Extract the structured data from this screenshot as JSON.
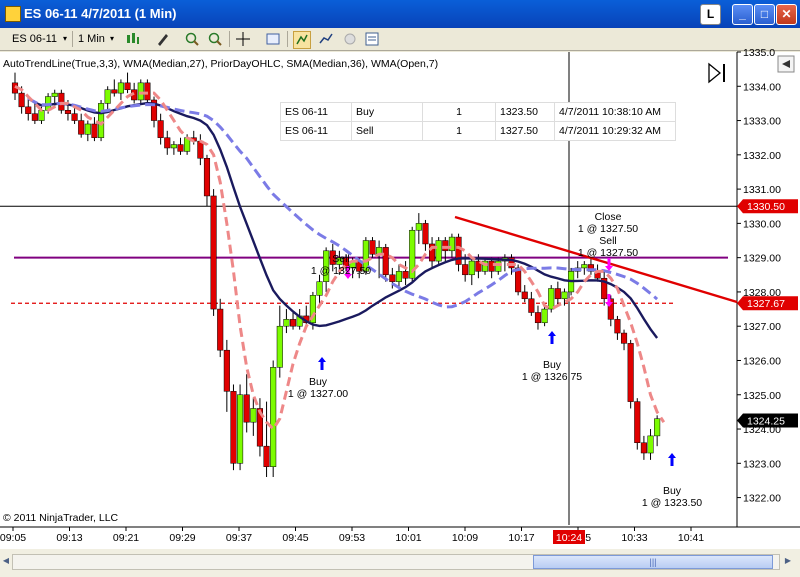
{
  "window": {
    "title": "ES 06-11  4/7/2011 (1 Min)",
    "link_label": "L",
    "minimize_label": "_",
    "maximize_label": "□",
    "close_label": "✕"
  },
  "toolbar": {
    "instrument": "ES 06-11",
    "interval": "1 Min",
    "dropdown_glyph": "▾",
    "icons": [
      "bar-style-icon",
      "drawing-tool-icon",
      "zoom-in-icon",
      "zoom-out-icon",
      "crosshair-icon",
      "properties-icon",
      "strategy-icon",
      "indicators-icon",
      "disabled-icon",
      "data-box-icon"
    ]
  },
  "indicators_label": "AutoTrendLine(True,3,3), WMA(Median,27), PriorDayOHLC, SMA(Median,36), WMA(Open,7)",
  "copyright": "© 2011 NinjaTrader, LLC",
  "executions": [
    {
      "instrument": "ES 06-11",
      "action": "Buy",
      "qty": "1",
      "price": "1323.50",
      "time": "4/7/2011 10:38:10 AM"
    },
    {
      "instrument": "ES 06-11",
      "action": "Sell",
      "qty": "1",
      "price": "1327.50",
      "time": "4/7/2011 10:29:32 AM"
    }
  ],
  "colors": {
    "up_bar": "#7cfc00",
    "down_bar": "#e00000",
    "wma27": "#1a1a5e",
    "sma36": "#7b7be6",
    "wma7": "#ee8888",
    "prior_close": "#800080",
    "prior_low": "#e00000",
    "trendline": "#e00000",
    "buy_arrow": "#0000ff",
    "sell_arrow": "#ff00ff"
  },
  "price_labels": {
    "last": "1324.25",
    "prior_close": "1330.50",
    "prior_low": "1327.67"
  },
  "time_badge": "10:24",
  "chart_data": {
    "type": "candlestick",
    "y_axis_ticks": [
      "1335.0",
      "1334.00",
      "1333.00",
      "1332.00",
      "1331.00",
      "1330.00",
      "1329.00",
      "1328.00",
      "1327.00",
      "1326.00",
      "1325.00",
      "1324.00",
      "1323.00",
      "1322.00"
    ],
    "ylim": [
      1321.2,
      1335.0
    ],
    "x_axis_ticks": [
      "09:05",
      "09:13",
      "09:21",
      "09:29",
      "09:37",
      "09:45",
      "09:53",
      "10:01",
      "10:09",
      "10:17",
      "10:25",
      "10:33",
      "10:41"
    ],
    "candles": [
      [
        1334.1,
        1334.4,
        1333.6,
        1333.8
      ],
      [
        1333.8,
        1334.0,
        1333.2,
        1333.4
      ],
      [
        1333.4,
        1333.7,
        1333.0,
        1333.2
      ],
      [
        1333.2,
        1333.5,
        1332.9,
        1333.0
      ],
      [
        1333.0,
        1333.4,
        1332.9,
        1333.3
      ],
      [
        1333.3,
        1333.8,
        1333.2,
        1333.7
      ],
      [
        1333.7,
        1333.9,
        1333.4,
        1333.8
      ],
      [
        1333.8,
        1333.9,
        1333.2,
        1333.3
      ],
      [
        1333.3,
        1333.6,
        1333.0,
        1333.2
      ],
      [
        1333.2,
        1333.4,
        1332.9,
        1333.0
      ],
      [
        1333.0,
        1333.2,
        1332.5,
        1332.6
      ],
      [
        1332.6,
        1333.0,
        1332.4,
        1332.9
      ],
      [
        1332.9,
        1333.1,
        1332.4,
        1332.5
      ],
      [
        1332.5,
        1333.6,
        1332.4,
        1333.5
      ],
      [
        1333.5,
        1334.0,
        1333.3,
        1333.9
      ],
      [
        1333.9,
        1334.2,
        1333.7,
        1333.8
      ],
      [
        1333.8,
        1334.2,
        1333.6,
        1334.1
      ],
      [
        1334.1,
        1334.4,
        1333.8,
        1333.9
      ],
      [
        1333.9,
        1334.1,
        1333.5,
        1333.6
      ],
      [
        1333.6,
        1334.2,
        1333.5,
        1334.1
      ],
      [
        1334.1,
        1334.2,
        1333.5,
        1333.6
      ],
      [
        1333.6,
        1333.7,
        1332.8,
        1333.0
      ],
      [
        1333.0,
        1333.2,
        1332.3,
        1332.5
      ],
      [
        1332.5,
        1332.7,
        1332.0,
        1332.2
      ],
      [
        1332.2,
        1332.4,
        1332.0,
        1332.3
      ],
      [
        1332.3,
        1332.5,
        1332.0,
        1332.1
      ],
      [
        1332.1,
        1332.6,
        1332.0,
        1332.5
      ],
      [
        1332.5,
        1332.7,
        1332.3,
        1332.4
      ],
      [
        1332.4,
        1332.6,
        1331.7,
        1331.9
      ],
      [
        1331.9,
        1332.0,
        1330.5,
        1330.8
      ],
      [
        1330.8,
        1331.0,
        1327.3,
        1327.5
      ],
      [
        1327.5,
        1327.8,
        1326.1,
        1326.3
      ],
      [
        1326.3,
        1326.6,
        1324.5,
        1325.1
      ],
      [
        1325.1,
        1325.3,
        1322.8,
        1323.0
      ],
      [
        1323.0,
        1325.3,
        1322.8,
        1325.0
      ],
      [
        1325.0,
        1325.6,
        1323.9,
        1324.2
      ],
      [
        1324.2,
        1324.9,
        1323.8,
        1324.6
      ],
      [
        1324.6,
        1324.9,
        1323.2,
        1323.5
      ],
      [
        1323.5,
        1324.8,
        1322.6,
        1322.9
      ],
      [
        1322.9,
        1326.0,
        1322.6,
        1325.8
      ],
      [
        1325.8,
        1327.6,
        1325.5,
        1327.0
      ],
      [
        1327.0,
        1327.5,
        1326.8,
        1327.2
      ],
      [
        1327.2,
        1327.4,
        1326.9,
        1327.0
      ],
      [
        1327.0,
        1327.5,
        1326.9,
        1327.3
      ],
      [
        1327.3,
        1327.6,
        1327.0,
        1327.1
      ],
      [
        1327.1,
        1328.0,
        1326.9,
        1327.9
      ],
      [
        1327.9,
        1328.5,
        1327.6,
        1328.3
      ],
      [
        1328.3,
        1329.3,
        1328.0,
        1329.2
      ],
      [
        1329.2,
        1329.4,
        1328.6,
        1328.8
      ],
      [
        1328.8,
        1329.2,
        1328.5,
        1329.0
      ],
      [
        1329.0,
        1329.1,
        1328.6,
        1328.7
      ],
      [
        1328.7,
        1329.0,
        1328.4,
        1328.9
      ],
      [
        1328.9,
        1329.0,
        1328.4,
        1328.6
      ],
      [
        1328.6,
        1329.6,
        1328.5,
        1329.5
      ],
      [
        1329.5,
        1329.6,
        1329.0,
        1329.1
      ],
      [
        1329.1,
        1329.5,
        1328.4,
        1329.3
      ],
      [
        1329.3,
        1329.4,
        1328.3,
        1328.5
      ],
      [
        1328.5,
        1328.7,
        1328.1,
        1328.3
      ],
      [
        1328.3,
        1328.8,
        1328.1,
        1328.6
      ],
      [
        1328.6,
        1328.9,
        1328.2,
        1328.4
      ],
      [
        1328.4,
        1329.9,
        1328.3,
        1329.8
      ],
      [
        1329.8,
        1330.3,
        1329.4,
        1330.0
      ],
      [
        1330.0,
        1330.1,
        1329.2,
        1329.4
      ],
      [
        1329.4,
        1329.6,
        1328.7,
        1328.9
      ],
      [
        1328.9,
        1329.6,
        1328.8,
        1329.5
      ],
      [
        1329.5,
        1329.6,
        1328.9,
        1329.2
      ],
      [
        1329.2,
        1329.7,
        1329.0,
        1329.6
      ],
      [
        1329.6,
        1329.7,
        1328.6,
        1328.8
      ],
      [
        1328.8,
        1329.1,
        1328.3,
        1328.5
      ],
      [
        1328.5,
        1329.0,
        1328.2,
        1328.9
      ],
      [
        1328.9,
        1329.1,
        1328.4,
        1328.6
      ],
      [
        1328.6,
        1329.0,
        1328.5,
        1328.9
      ],
      [
        1328.9,
        1329.0,
        1328.4,
        1328.6
      ],
      [
        1328.6,
        1329.0,
        1328.5,
        1328.9
      ],
      [
        1328.9,
        1329.1,
        1328.6,
        1329.0
      ],
      [
        1329.0,
        1329.1,
        1328.5,
        1328.7
      ],
      [
        1328.7,
        1328.8,
        1327.9,
        1328.0
      ],
      [
        1328.0,
        1328.2,
        1327.7,
        1327.8
      ],
      [
        1327.8,
        1328.0,
        1327.3,
        1327.4
      ],
      [
        1327.4,
        1327.6,
        1326.9,
        1327.1
      ],
      [
        1327.1,
        1327.6,
        1327.0,
        1327.5
      ],
      [
        1327.5,
        1328.2,
        1327.4,
        1328.1
      ],
      [
        1328.1,
        1328.3,
        1327.6,
        1327.8
      ],
      [
        1327.8,
        1328.1,
        1327.6,
        1328.0
      ],
      [
        1328.0,
        1328.7,
        1327.9,
        1328.6
      ],
      [
        1328.6,
        1328.9,
        1328.4,
        1328.7
      ],
      [
        1328.7,
        1328.9,
        1328.5,
        1328.8
      ],
      [
        1328.8,
        1329.0,
        1328.5,
        1328.6
      ],
      [
        1328.6,
        1328.8,
        1328.3,
        1328.4
      ],
      [
        1328.4,
        1328.6,
        1327.6,
        1327.8
      ],
      [
        1327.8,
        1327.9,
        1327.0,
        1327.2
      ],
      [
        1327.2,
        1327.3,
        1326.6,
        1326.8
      ],
      [
        1326.8,
        1326.9,
        1326.3,
        1326.5
      ],
      [
        1326.5,
        1326.6,
        1324.6,
        1324.8
      ],
      [
        1324.8,
        1324.9,
        1323.4,
        1323.6
      ],
      [
        1323.6,
        1323.8,
        1323.1,
        1323.3
      ],
      [
        1323.3,
        1324.0,
        1323.1,
        1323.8
      ],
      [
        1323.8,
        1324.4,
        1323.5,
        1324.3
      ]
    ],
    "wma7_open": [
      1334.0,
      1333.9,
      1333.7,
      1333.5,
      1333.3,
      1333.3,
      1333.4,
      1333.5,
      1333.5,
      1333.4,
      1333.3,
      1333.1,
      1333.0,
      1332.9,
      1333.1,
      1333.3,
      1333.5,
      1333.7,
      1333.8,
      1333.8,
      1333.8,
      1333.8,
      1333.6,
      1333.3,
      1333.0,
      1332.7,
      1332.5,
      1332.4,
      1332.4,
      1332.3,
      1332.0,
      1331.2,
      1330.0,
      1328.6,
      1327.0,
      1325.8,
      1325.0,
      1324.5,
      1324.2,
      1324.0,
      1324.3,
      1325.1,
      1325.9,
      1326.5,
      1327.0,
      1327.3,
      1327.6,
      1327.9,
      1328.3,
      1328.6,
      1328.8,
      1328.9,
      1328.9,
      1328.9,
      1329.0,
      1329.1,
      1329.1,
      1329.0,
      1328.8,
      1328.7,
      1328.6,
      1328.8,
      1329.1,
      1329.3,
      1329.3,
      1329.3,
      1329.3,
      1329.3,
      1329.2,
      1329.0,
      1328.9,
      1328.8,
      1328.8,
      1328.8,
      1328.8,
      1328.8,
      1328.8,
      1328.6,
      1328.3,
      1328.0,
      1327.6,
      1327.5,
      1327.6,
      1327.7,
      1327.8,
      1328.0,
      1328.3,
      1328.5,
      1328.6,
      1328.6,
      1328.4,
      1328.1,
      1327.6,
      1327.1,
      1326.5,
      1325.8,
      1325.0,
      1324.5,
      1324.2
    ]
  },
  "trade_markers": [
    {
      "label_line1": "Sell",
      "label_line2": "1 @ 1327.50",
      "side": "sell"
    },
    {
      "label_line1": "Buy",
      "label_line2": "1 @ 1327.00",
      "side": "buy"
    },
    {
      "label_line1": "Buy",
      "label_line2": "1 @ 1326.75",
      "side": "buy"
    },
    {
      "label_line1": "Close",
      "label_line2": "1 @ 1327.50",
      "side": "sell"
    },
    {
      "label_line1": "Sell",
      "label_line2": "1 @ 1327.50",
      "side": "sell"
    },
    {
      "label_line1": "Buy",
      "label_line2": "1 @ 1323.50",
      "side": "buy"
    }
  ]
}
